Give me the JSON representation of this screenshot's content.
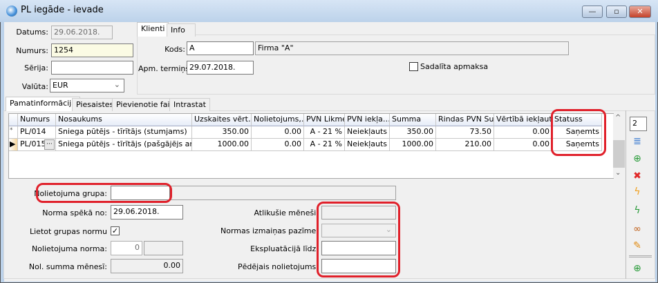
{
  "window": {
    "title": "PL iegāde - ievade",
    "minimize": "—",
    "maximize": "▫",
    "close": "✕"
  },
  "header": {
    "datums_label": "Datums:",
    "datums": "29.06.2018.",
    "numurs_label": "Numurs:",
    "numurs": "1254",
    "serija_label": "Sērija:",
    "serija": "",
    "valuta_label": "Valūta:",
    "valuta": "EUR"
  },
  "client_tabs": [
    "Klienti",
    "Info"
  ],
  "client": {
    "kods_label": "Kods:",
    "kods": "A",
    "firma": "Firma \"A\"",
    "apm_label": "Apm. termiņš:",
    "apm": "29.07.2018.",
    "sadalita_label": "Sadalīta apmaksa",
    "sadalita_checked": false
  },
  "main_tabs": [
    "Pamatinformācija",
    "Piesaistes",
    "Pievienotie faili",
    "Intrastat"
  ],
  "grid": {
    "columns": [
      "Numurs",
      "Nosaukums",
      "Uzskaites vērt…",
      "Nolietojums,…",
      "PVN Likme",
      "PVN iekļa…",
      "Summa",
      "Rindas PVN Su",
      "Vērtībā iekļaut…",
      "Statuss"
    ],
    "rows": [
      {
        "marker": "*",
        "cells": [
          "PL/014",
          "Sniega pūtējs - tīrītājs (stumjams)",
          "350.00",
          "0.00",
          "A - 21 %",
          "Neiekļauts",
          "350.00",
          "73.50",
          "0.00",
          "Saņemts"
        ]
      },
      {
        "marker": "▶",
        "cells": [
          "PL/015",
          "Sniega pūtējs - tīrītājs (pašgājējs ar …",
          "1000.00",
          "0.00",
          "A - 21 %",
          "Neiekļauts",
          "1000.00",
          "210.00",
          "0.00",
          "Saņemts"
        ]
      }
    ],
    "ellipsis": "···"
  },
  "toolbar": {
    "count": "2",
    "icons": [
      "move-rows-icon",
      "add-row-icon",
      "delete-icon",
      "lightning-orange-icon",
      "lightning-green-icon",
      "view-document-icon",
      "edit-icon",
      "new-document-icon"
    ]
  },
  "detail": {
    "grupa_label": "Nolietojuma grupa:",
    "grupa": "",
    "grupa_name": "",
    "norma_no_label": "Norma spēkā no:",
    "norma_no": "29.06.2018.",
    "lietot_label": "Lietot grupas normu",
    "lietot_checked": true,
    "norma_label": "Nolietojuma norma:",
    "norma": "0",
    "norma2": "",
    "summa_label": "Nol. summa mēnesī:",
    "summa": "0.00",
    "atlikusie_label": "Atlikušie mēneši:",
    "atlikusie": "",
    "izmainas_label": "Normas izmaiņas pazīme:",
    "izmainas": "",
    "ekspl_label": "Ekspluatācijā līdz:",
    "ekspl": "",
    "pedejais_label": "Pēdējais nolietojums:",
    "pedejais": ""
  }
}
